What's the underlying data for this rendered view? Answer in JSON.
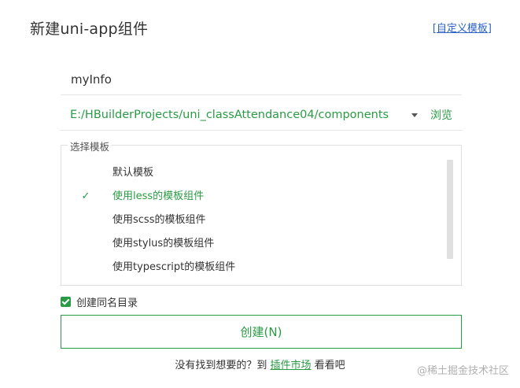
{
  "dialog": {
    "title": "新建uni-app组件",
    "custom_template": {
      "open_bracket": "[",
      "label": "自定义模板",
      "close_bracket": "]"
    }
  },
  "name_field": {
    "value": "myInfo",
    "placeholder": ""
  },
  "path_field": {
    "value": "E:/HBuilderProjects/uni_classAttendance04/components",
    "browse_label": "浏览"
  },
  "template_group": {
    "legend": "选择模板",
    "check_glyph": "✓",
    "items": [
      {
        "label": "默认模板",
        "selected": false
      },
      {
        "label": "使用less的模板组件",
        "selected": true
      },
      {
        "label": "使用scss的模板组件",
        "selected": false
      },
      {
        "label": "使用stylus的模板组件",
        "selected": false
      },
      {
        "label": "使用typescript的模板组件",
        "selected": false
      }
    ]
  },
  "create_dir": {
    "label": "创建同名目录",
    "checked": true
  },
  "create_button": {
    "label": "创建(N)"
  },
  "footer": {
    "prefix": "没有找到想要的？到 ",
    "market_link": "插件市场",
    "suffix": " 看看吧"
  },
  "watermark": "@稀土掘金技术社区",
  "colors": {
    "accent_green": "#2a9a44",
    "link_blue": "#2b62c8"
  }
}
